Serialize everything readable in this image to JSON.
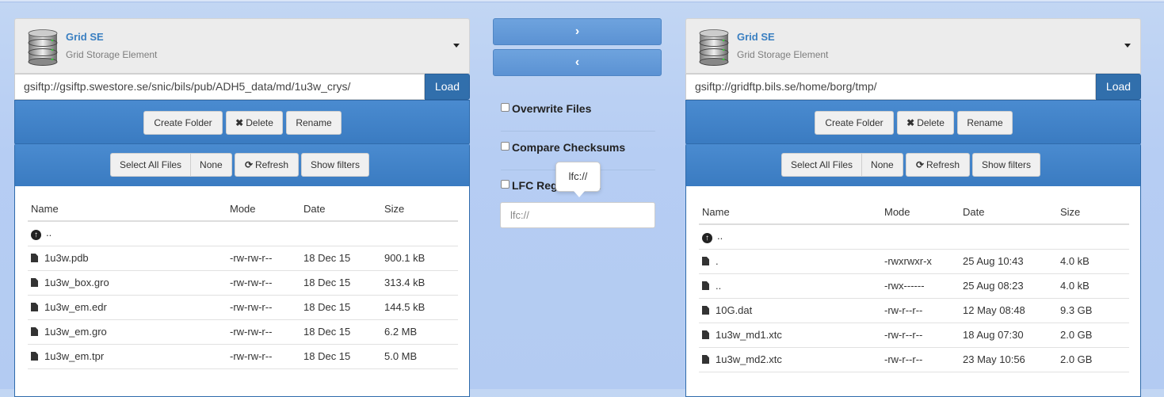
{
  "transfer": {
    "right_arrow": "›",
    "left_arrow": "‹",
    "options": [
      {
        "label": "Overwrite Files",
        "checked": false
      },
      {
        "label": "Compare Checksums",
        "checked": false
      },
      {
        "label": "LFC Registration",
        "checked": false
      }
    ],
    "lfc_input_value": "lfc://",
    "tooltip": "lfc://"
  },
  "left": {
    "se_title": "Grid SE",
    "se_subtitle": "Grid Storage Element",
    "url": "gsiftp://gsiftp.swestore.se/snic/bils/pub/ADH5_data/md/1u3w_crys/",
    "load_label": "Load",
    "create_folder_label": "Create Folder",
    "delete_label": "Delete",
    "rename_label": "Rename",
    "select_all_label": "Select All Files",
    "none_label": "None",
    "refresh_label": "Refresh",
    "show_filters_label": "Show filters",
    "columns": [
      "Name",
      "Mode",
      "Date",
      "Size"
    ],
    "parent_label": "..",
    "rows": [
      {
        "name": "1u3w.pdb",
        "mode": "-rw-rw-r--",
        "date": "18 Dec 15",
        "size": "900.1 kB"
      },
      {
        "name": "1u3w_box.gro",
        "mode": "-rw-rw-r--",
        "date": "18 Dec 15",
        "size": "313.4 kB"
      },
      {
        "name": "1u3w_em.edr",
        "mode": "-rw-rw-r--",
        "date": "18 Dec 15",
        "size": "144.5 kB"
      },
      {
        "name": "1u3w_em.gro",
        "mode": "-rw-rw-r--",
        "date": "18 Dec 15",
        "size": "6.2 MB"
      },
      {
        "name": "1u3w_em.tpr",
        "mode": "-rw-rw-r--",
        "date": "18 Dec 15",
        "size": "5.0 MB"
      }
    ]
  },
  "right": {
    "se_title": "Grid SE",
    "se_subtitle": "Grid Storage Element",
    "url": "gsiftp://gridftp.bils.se/home/borg/tmp/",
    "load_label": "Load",
    "create_folder_label": "Create Folder",
    "delete_label": "Delete",
    "rename_label": "Rename",
    "select_all_label": "Select All Files",
    "none_label": "None",
    "refresh_label": "Refresh",
    "show_filters_label": "Show filters",
    "columns": [
      "Name",
      "Mode",
      "Date",
      "Size"
    ],
    "parent_label": "..",
    "rows": [
      {
        "name": ".",
        "mode": "-rwxrwxr-x",
        "date": "25 Aug 10:43",
        "size": "4.0 kB"
      },
      {
        "name": "..",
        "mode": "-rwx------",
        "date": "25 Aug 08:23",
        "size": "4.0 kB"
      },
      {
        "name": "10G.dat",
        "mode": "-rw-r--r--",
        "date": "12 May 08:48",
        "size": "9.3 GB"
      },
      {
        "name": "1u3w_md1.xtc",
        "mode": "-rw-r--r--",
        "date": "18 Aug 07:30",
        "size": "2.0 GB"
      },
      {
        "name": "1u3w_md2.xtc",
        "mode": "-rw-r--r--",
        "date": "23 May 10:56",
        "size": "2.0 GB"
      }
    ]
  }
}
